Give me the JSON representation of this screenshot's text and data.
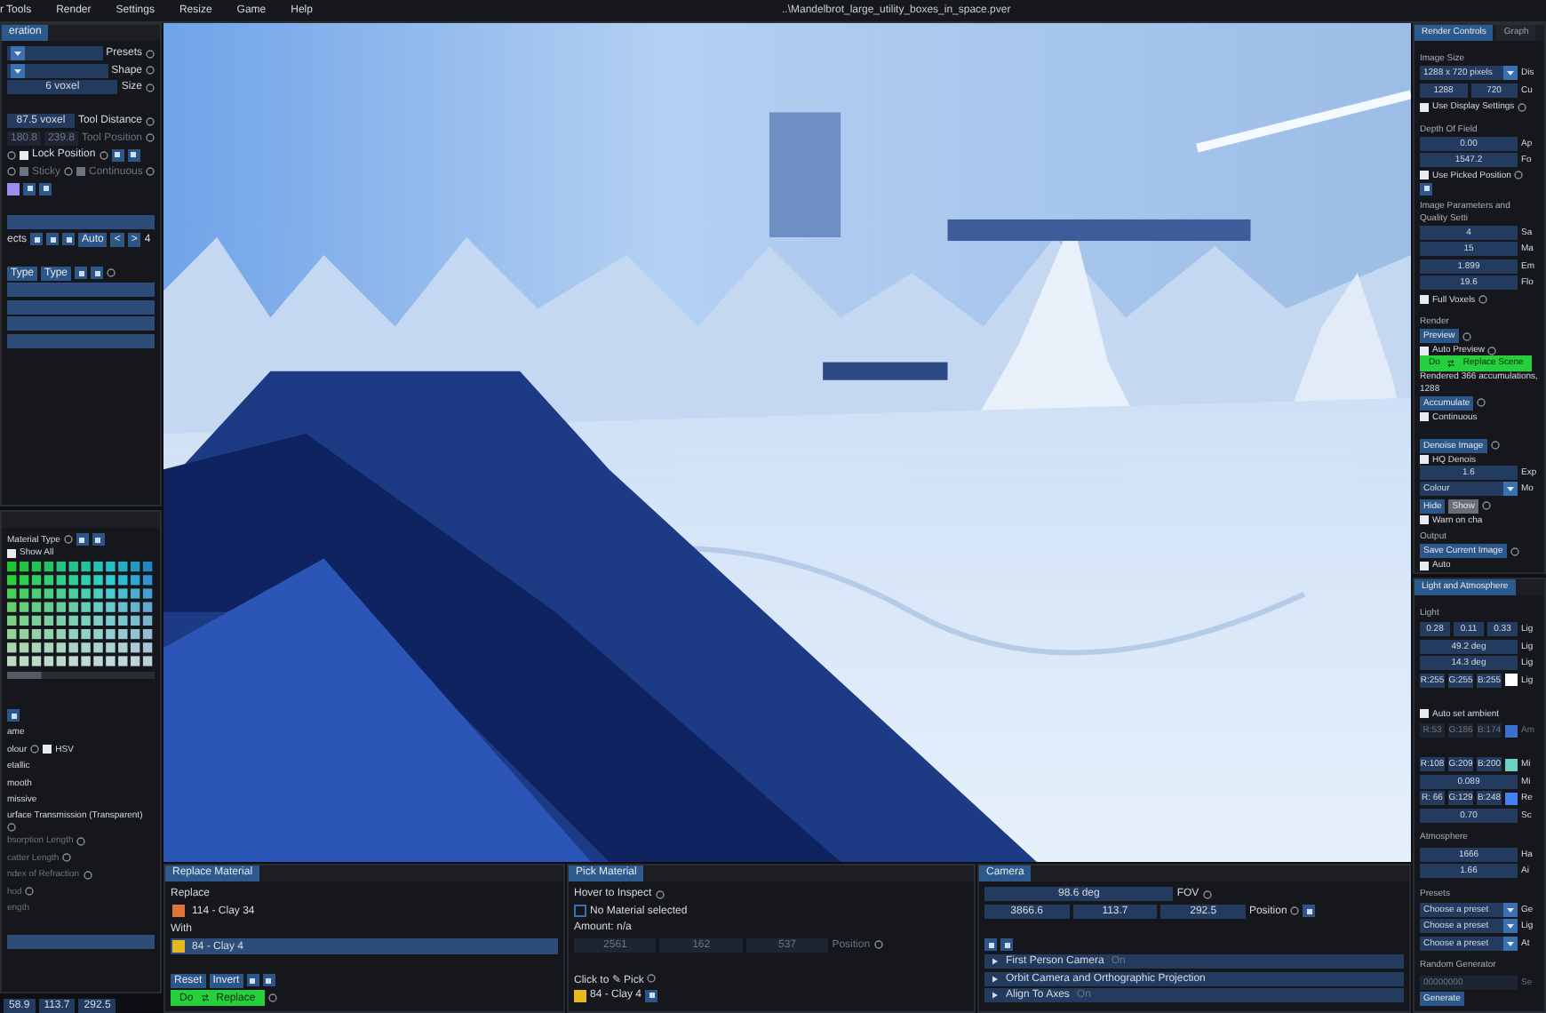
{
  "menu": [
    "r Tools",
    "Render",
    "Settings",
    "Resize",
    "Game",
    "Help"
  ],
  "file_title": "..\\Mandelbrot_large_utility_boxes_in_space.pver",
  "left_top": {
    "tab": {
      "label": "eration",
      "selected": true
    },
    "rows": [
      [
        {
          "kind": "select"
        },
        {
          "kind": "label",
          "text": "Presets"
        },
        {
          "kind": "help"
        }
      ],
      [
        {
          "kind": "select"
        },
        {
          "kind": "label",
          "text": "Shape"
        },
        {
          "kind": "help"
        }
      ],
      [
        {
          "kind": "field",
          "value": "6 voxel"
        },
        {
          "kind": "label",
          "text": "Size"
        },
        {
          "kind": "help"
        }
      ],
      [
        {
          "kind": "spacer"
        }
      ],
      [
        {
          "kind": "field",
          "value": "87.5 voxel"
        },
        {
          "kind": "label",
          "text": "Tool Distance"
        },
        {
          "kind": "help"
        }
      ],
      [
        {
          "kind": "field",
          "value": "180.8",
          "disabled": true
        },
        {
          "kind": "field",
          "value": "239.8",
          "disabled": true
        },
        {
          "kind": "label",
          "text": "Tool Position",
          "disabled": true
        },
        {
          "kind": "help"
        }
      ],
      [
        {
          "kind": "help"
        },
        {
          "kind": "check",
          "label": "Lock Position",
          "checked": false
        },
        {
          "kind": "help"
        },
        {
          "kind": "icon_button"
        },
        {
          "kind": "icon_button"
        }
      ],
      [
        {
          "kind": "help"
        },
        {
          "kind": "check",
          "label": "Sticky",
          "checked": false,
          "disabled": true
        },
        {
          "kind": "help"
        },
        {
          "kind": "check",
          "label": "Continuous",
          "checked": false,
          "disabled": true
        },
        {
          "kind": "help"
        }
      ],
      [
        {
          "kind": "swatch",
          "color": "#9b8cf0"
        },
        {
          "kind": "icon_button"
        },
        {
          "kind": "icon_button"
        }
      ],
      [
        {
          "kind": "spacer"
        }
      ],
      [
        {
          "kind": "list_row"
        }
      ],
      [
        {
          "kind": "label",
          "text": "ects"
        },
        {
          "kind": "icon_button"
        },
        {
          "kind": "icon_button"
        },
        {
          "kind": "icon_button"
        },
        {
          "kind": "button",
          "text": "Auto"
        },
        {
          "kind": "button",
          "text": "<"
        },
        {
          "kind": "button",
          "text": ">"
        },
        {
          "kind": "label",
          "text": "4"
        }
      ],
      [
        {
          "kind": "spacer"
        }
      ],
      [
        {
          "kind": "button",
          "text": "Type"
        },
        {
          "kind": "button",
          "text": "Type"
        },
        {
          "kind": "icon_button"
        },
        {
          "kind": "icon_button"
        },
        {
          "kind": "help"
        }
      ],
      [
        {
          "kind": "list_row"
        }
      ],
      [
        {
          "kind": "list_row"
        }
      ],
      [
        {
          "kind": "list_row"
        }
      ],
      [
        {
          "kind": "list_row"
        }
      ]
    ]
  },
  "left_bottom": {
    "rows": [
      [
        {
          "kind": "label",
          "text": "Material Type"
        },
        {
          "kind": "help"
        },
        {
          "kind": "icon_button"
        },
        {
          "kind": "icon_button"
        },
        {
          "kind": "check",
          "label": "Show All",
          "checked": false
        }
      ],
      [
        {
          "kind": "palette"
        }
      ],
      [
        {
          "kind": "spacer"
        }
      ],
      [
        {
          "kind": "icon_button"
        }
      ],
      [
        {
          "kind": "label",
          "text": "ame"
        }
      ],
      [
        {
          "kind": "label",
          "text": "olour"
        },
        {
          "kind": "help"
        },
        {
          "kind": "check",
          "label": "HSV",
          "checked": false
        }
      ],
      [
        {
          "kind": "label",
          "text": "etallic"
        }
      ],
      [
        {
          "kind": "label",
          "text": "mooth"
        }
      ],
      [
        {
          "kind": "label",
          "text": "missive"
        }
      ],
      [
        {
          "kind": "label",
          "text": "urface Transmission (Transparent)"
        },
        {
          "kind": "help"
        }
      ],
      [
        {
          "kind": "label",
          "text": "bsorption Length",
          "disabled": true
        },
        {
          "kind": "help"
        }
      ],
      [
        {
          "kind": "label",
          "text": "catter Length",
          "disabled": true
        },
        {
          "kind": "help"
        }
      ],
      [
        {
          "kind": "label",
          "text": "ndex of Refraction",
          "disabled": true
        },
        {
          "kind": "help"
        }
      ],
      [
        {
          "kind": "label",
          "text": "hod",
          "disabled": true
        },
        {
          "kind": "help"
        }
      ],
      [
        {
          "kind": "label",
          "text": "ength",
          "disabled": true
        }
      ],
      [
        {
          "kind": "spacer"
        }
      ],
      [
        {
          "kind": "list_row"
        }
      ]
    ]
  },
  "status": [
    "58.9",
    "113.7",
    "292.5"
  ],
  "replace_material": {
    "tab": {
      "label": "Replace Material",
      "selected": true
    },
    "rows": [
      [
        {
          "kind": "label",
          "text": "Replace"
        }
      ],
      [
        {
          "kind": "list_item",
          "color": "#e0743a",
          "text": "114 - Clay 34",
          "selected": false
        }
      ],
      [
        {
          "kind": "label",
          "text": "With"
        }
      ],
      [
        {
          "kind": "list_item",
          "color": "#e8b820",
          "text": "84 - Clay 4",
          "selected": true
        }
      ],
      [
        {
          "kind": "spacer"
        }
      ],
      [
        {
          "kind": "button",
          "text": "Reset"
        },
        {
          "kind": "button",
          "text": "Invert"
        },
        {
          "kind": "icon_button"
        },
        {
          "kind": "icon_button"
        }
      ],
      [
        {
          "kind": "go",
          "text": "Do",
          "text2": "Replace"
        },
        {
          "kind": "help"
        }
      ]
    ]
  },
  "pick_material": {
    "tab": {
      "label": "Pick Material",
      "selected": true
    },
    "rows": [
      [
        {
          "kind": "label",
          "text": "Hover to Inspect"
        },
        {
          "kind": "help"
        }
      ],
      [
        {
          "kind": "swatch"
        },
        {
          "kind": "label",
          "text": "No Material selected"
        }
      ],
      [
        {
          "kind": "label",
          "text": "Amount: n/a"
        }
      ],
      [
        {
          "kind": "field",
          "value": "2561",
          "disabled": true
        },
        {
          "kind": "field",
          "value": "162",
          "disabled": true
        },
        {
          "kind": "field",
          "value": "537",
          "disabled": true
        },
        {
          "kind": "label",
          "text": "Position",
          "disabled": true
        },
        {
          "kind": "help"
        },
        {
          "kind": "spacer"
        }
      ],
      [
        {
          "kind": "spacer"
        }
      ],
      [
        {
          "kind": "label",
          "text": "Click to ✎ Pick"
        },
        {
          "kind": "help"
        }
      ],
      [
        {
          "kind": "swatch",
          "color": "#e8b820"
        },
        {
          "kind": "label",
          "text": "84 - Clay 4"
        },
        {
          "kind": "icon_button"
        }
      ]
    ]
  },
  "camera": {
    "tab": {
      "label": "Camera",
      "selected": true
    },
    "rows": [
      [
        {
          "kind": "field",
          "value": "98.6 deg"
        },
        {
          "kind": "label",
          "text": "FOV"
        },
        {
          "kind": "help"
        },
        {
          "kind": "spacer"
        }
      ],
      [
        {
          "kind": "field",
          "value": "3866.6"
        },
        {
          "kind": "field",
          "value": "113.7"
        },
        {
          "kind": "field",
          "value": "292.5"
        },
        {
          "kind": "label",
          "text": "Position"
        },
        {
          "kind": "help"
        },
        {
          "kind": "icon_button"
        },
        {
          "kind": "spacer"
        }
      ],
      [
        {
          "kind": "spacer"
        }
      ],
      [
        {
          "kind": "icon_button"
        },
        {
          "kind": "icon_button"
        }
      ],
      [
        {
          "kind": "header",
          "text": "First Person Camera",
          "note": "On"
        }
      ],
      [
        {
          "kind": "header",
          "text": "Orbit Camera and Orthographic Projection"
        }
      ],
      [
        {
          "kind": "header",
          "text": "Align To Axes",
          "note": "On"
        }
      ]
    ]
  },
  "render_controls": {
    "tabs": [
      {
        "label": "Render Controls",
        "selected": true
      },
      {
        "label": "Graph",
        "selected": false
      }
    ],
    "rows": [
      [
        {
          "kind": "heading",
          "text": "Image Size"
        }
      ],
      [
        {
          "kind": "select",
          "value": "1288 x 720 pixels"
        },
        {
          "kind": "label",
          "text": "Dis"
        }
      ],
      [
        {
          "kind": "field_group",
          "values": [
            "1288",
            "720"
          ]
        },
        {
          "kind": "label",
          "text": "Cu"
        }
      ],
      [
        {
          "kind": "check",
          "label": "Use Display Settings",
          "checked": false
        },
        {
          "kind": "help"
        }
      ],
      [
        {
          "kind": "heading",
          "text": "Depth Of Field"
        }
      ],
      [
        {
          "kind": "field",
          "value": "0.00"
        },
        {
          "kind": "label",
          "text": "Ap"
        }
      ],
      [
        {
          "kind": "field",
          "value": "1547.2"
        },
        {
          "kind": "label",
          "text": "Fo"
        }
      ],
      [
        {
          "kind": "check",
          "label": "Use Picked Position",
          "checked": false
        },
        {
          "kind": "help"
        },
        {
          "kind": "icon_button"
        }
      ],
      [
        {
          "kind": "heading",
          "text": "Image Parameters and Quality Setti"
        }
      ],
      [
        {
          "kind": "field",
          "value": "4"
        },
        {
          "kind": "label",
          "text": "Sa"
        }
      ],
      [
        {
          "kind": "field",
          "value": "15"
        },
        {
          "kind": "label",
          "text": "Ma"
        }
      ],
      [
        {
          "kind": "field",
          "value": "1.899"
        },
        {
          "kind": "label",
          "text": "Em"
        }
      ],
      [
        {
          "kind": "field",
          "value": "19.6"
        },
        {
          "kind": "label",
          "text": "Flo"
        }
      ],
      [
        {
          "kind": "check",
          "label": "Full Voxels",
          "checked": false
        },
        {
          "kind": "help"
        }
      ],
      [
        {
          "kind": "heading",
          "text": "Render"
        }
      ],
      [
        {
          "kind": "button",
          "text": "Preview"
        },
        {
          "kind": "help"
        },
        {
          "kind": "check",
          "label": "Auto Preview",
          "checked": false
        },
        {
          "kind": "help"
        }
      ],
      [
        {
          "kind": "go",
          "text": "Do",
          "text2": "Replace Scene"
        }
      ],
      [
        {
          "kind": "text",
          "text": "Rendered 366 accumulations, 1288"
        }
      ],
      [
        {
          "kind": "button",
          "text": "Accumulate"
        },
        {
          "kind": "help"
        },
        {
          "kind": "check",
          "label": "Continuous",
          "checked": false
        }
      ],
      [
        {
          "kind": "spacer"
        }
      ],
      [
        {
          "kind": "button",
          "text": "Denoise Image"
        },
        {
          "kind": "help"
        },
        {
          "kind": "check",
          "label": "HQ Denois",
          "checked": false
        }
      ],
      [
        {
          "kind": "field",
          "value": "1.6"
        },
        {
          "kind": "label",
          "text": "Exp"
        }
      ],
      [
        {
          "kind": "select",
          "value": "Colour"
        },
        {
          "kind": "label",
          "text": "Mo"
        }
      ],
      [
        {
          "kind": "toggle_group",
          "items": [
            {
              "text": "Hide",
              "selected": false
            },
            {
              "text": "Show",
              "selected": true
            }
          ]
        },
        {
          "kind": "help"
        },
        {
          "kind": "check",
          "label": "Warn on cha",
          "checked": false
        }
      ],
      [
        {
          "kind": "heading",
          "text": "Output"
        }
      ],
      [
        {
          "kind": "button",
          "text": "Save Current Image"
        },
        {
          "kind": "help"
        },
        {
          "kind": "check",
          "label": "Auto",
          "checked": false
        }
      ]
    ]
  },
  "light": {
    "tabs": [
      {
        "label": "Light and Atmosphere",
        "selected": true
      }
    ],
    "rows": [
      [
        {
          "kind": "heading",
          "text": "Light"
        }
      ],
      [
        {
          "kind": "field",
          "value": "0.28"
        },
        {
          "kind": "field",
          "value": "0.11"
        },
        {
          "kind": "field",
          "value": "0.33"
        },
        {
          "kind": "label",
          "text": "Lig"
        }
      ],
      [
        {
          "kind": "field",
          "value": "49.2 deg"
        },
        {
          "kind": "label",
          "text": "Lig"
        }
      ],
      [
        {
          "kind": "field",
          "value": "14.3 deg"
        },
        {
          "kind": "label",
          "text": "Lig"
        }
      ],
      [
        {
          "kind": "field",
          "value": "R:255"
        },
        {
          "kind": "field",
          "value": "G:255"
        },
        {
          "kind": "field",
          "value": "B:255"
        },
        {
          "kind": "swatch",
          "color": "#ffffff"
        },
        {
          "kind": "label",
          "text": "Lig"
        }
      ],
      [
        {
          "kind": "spacer"
        }
      ],
      [
        {
          "kind": "check",
          "label": "Auto set ambient",
          "checked": false
        }
      ],
      [
        {
          "kind": "field",
          "value": "R:53",
          "disabled": true
        },
        {
          "kind": "field",
          "value": "G:186",
          "disabled": true
        },
        {
          "kind": "field",
          "value": "B:174",
          "disabled": true
        },
        {
          "kind": "swatch",
          "color": "#3b6fd0"
        },
        {
          "kind": "label",
          "text": "Am",
          "disabled": true
        }
      ],
      [
        {
          "kind": "spacer"
        }
      ],
      [
        {
          "kind": "field",
          "value": "R:108"
        },
        {
          "kind": "field",
          "value": "G:209"
        },
        {
          "kind": "field",
          "value": "B:200"
        },
        {
          "kind": "swatch",
          "color": "#6cd0c8"
        },
        {
          "kind": "label",
          "text": "Mi"
        }
      ],
      [
        {
          "kind": "field",
          "value": "0.089"
        },
        {
          "kind": "label",
          "text": "Mi"
        }
      ],
      [
        {
          "kind": "field",
          "value": "R: 66"
        },
        {
          "kind": "field",
          "value": "G:129"
        },
        {
          "kind": "field",
          "value": "B:248"
        },
        {
          "kind": "swatch",
          "color": "#4281f8"
        },
        {
          "kind": "label",
          "text": "Re"
        }
      ],
      [
        {
          "kind": "field",
          "value": "0.70"
        },
        {
          "kind": "label",
          "text": "Sc"
        }
      ],
      [
        {
          "kind": "heading",
          "text": "Atmosphere"
        }
      ],
      [
        {
          "kind": "field",
          "value": "1666"
        },
        {
          "kind": "label",
          "text": "Ha"
        }
      ],
      [
        {
          "kind": "field",
          "value": "1.66"
        },
        {
          "kind": "label",
          "text": "Ai"
        }
      ],
      [
        {
          "kind": "heading",
          "text": "Presets"
        }
      ],
      [
        {
          "kind": "select",
          "value": "Choose a preset"
        },
        {
          "kind": "label",
          "text": "Ge"
        }
      ],
      [
        {
          "kind": "select",
          "value": "Choose a preset"
        },
        {
          "kind": "label",
          "text": "Lig"
        }
      ],
      [
        {
          "kind": "select",
          "value": "Choose a preset"
        },
        {
          "kind": "label",
          "text": "At"
        }
      ],
      [
        {
          "kind": "heading",
          "text": "Random Generator"
        }
      ],
      [
        {
          "kind": "input",
          "placeholder": "00000000"
        },
        {
          "kind": "label",
          "text": "Se",
          "disabled": true
        }
      ],
      [
        {
          "kind": "button",
          "text": "Generate"
        }
      ]
    ]
  }
}
